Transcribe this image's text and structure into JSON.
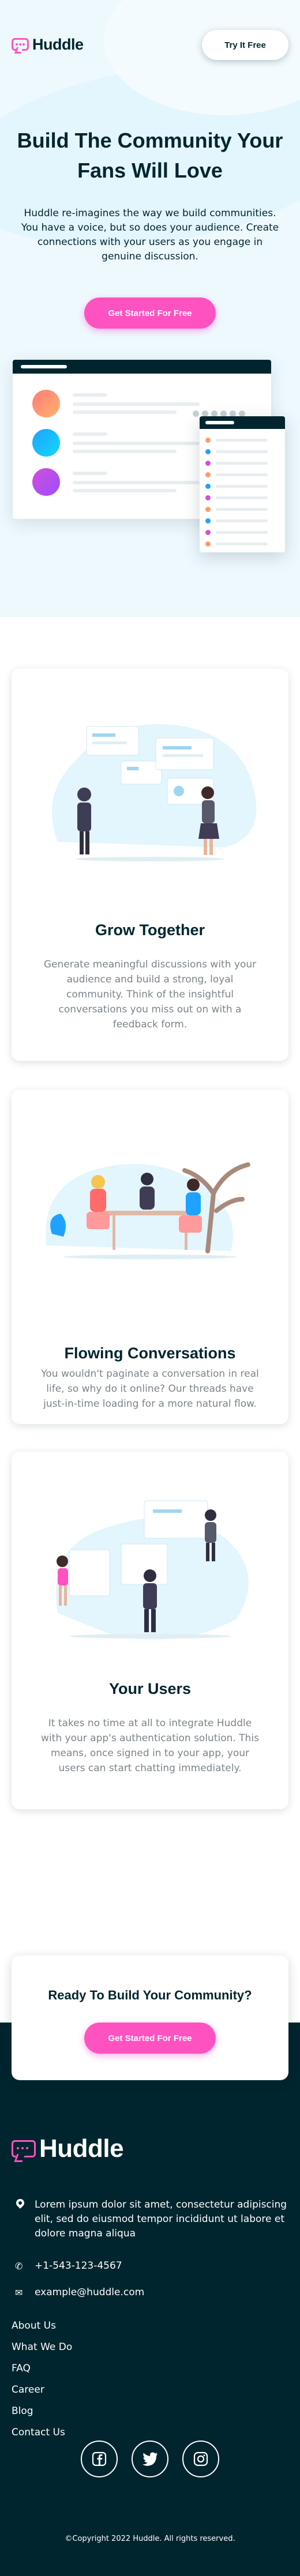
{
  "header": {
    "logo_text": "Huddle",
    "try_button": "Try It Free"
  },
  "hero": {
    "title": "Build The Community Your Fans Will Love",
    "description": "Huddle re-imagines the way we build communities. You have a voice, but so does your audience. Create connections with your users as you engage in genuine discussion.",
    "cta": "Get Started For Free"
  },
  "features": [
    {
      "title": "Grow Together",
      "text": "Generate meaningful discussions with your audience and build a strong, loyal community. Think of the insightful conversations you miss out on with a feedback form."
    },
    {
      "title": "Flowing Conversations",
      "text": "You wouldn't paginate a conversation in real life, so why do it online? Our threads have just-in-time loading for a more natural flow."
    },
    {
      "title": "Your Users",
      "text": "It takes no time at all to integrate Huddle with your app's authentication solution. This means, once signed in to your app, your users can start chatting immediately."
    }
  ],
  "cta_card": {
    "title": "Ready To Build Your Community?",
    "button": "Get Started For Free"
  },
  "footer": {
    "logo_text": "Huddle",
    "address": "Lorem ipsum dolor sit amet, consectetur adipiscing elit, sed do eiusmod tempor incididunt ut labore et dolore magna aliqua",
    "phone": "+1-543-123-4567",
    "email": "example@huddle.com",
    "links": [
      "About Us",
      "What We Do",
      "FAQ",
      "Career",
      "Blog",
      "Contact Us"
    ],
    "social_icons": [
      "facebook-icon",
      "twitter-icon",
      "instagram-icon"
    ],
    "copyright": "©Copyright 2022 Huddle. All rights reserved."
  },
  "colors": {
    "dark_cyan": "#00252e",
    "pink": "#ff52c1",
    "light_blue_bg": "#eef9fe",
    "gray_text": "#7b8489"
  }
}
